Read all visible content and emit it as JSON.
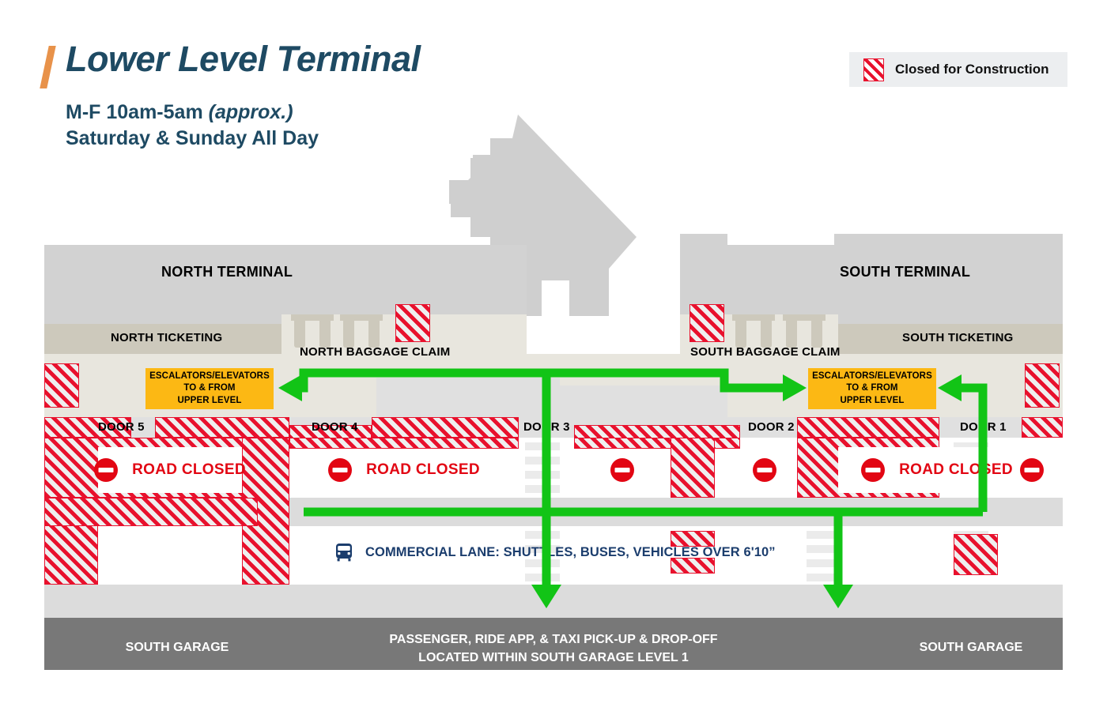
{
  "header": {
    "title": "Lower Level Terminal",
    "subtitle_line1_main": "M-F 10am-5am ",
    "subtitle_line1_italic": "(approx.)",
    "subtitle_line2": "Saturday & Sunday All Day",
    "accent_color": "#e8924a",
    "title_color": "#1e4a63"
  },
  "legend": {
    "swatch_icon": "hatched-red-square-icon",
    "label": "Closed for Construction",
    "hatch_color": "#e8112d",
    "background": "#eceef0"
  },
  "map": {
    "terminals": [
      {
        "id": "north",
        "label": "NORTH TERMINAL"
      },
      {
        "id": "south",
        "label": "SOUTH TERMINAL"
      }
    ],
    "ticketing": [
      {
        "id": "north",
        "label": "NORTH TICKETING"
      },
      {
        "id": "south",
        "label": "SOUTH TICKETING"
      }
    ],
    "baggage_claim": [
      {
        "id": "north",
        "label": "NORTH BAGGAGE CLAIM"
      },
      {
        "id": "south",
        "label": "SOUTH BAGGAGE CLAIM"
      }
    ],
    "escalator_boxes": [
      {
        "id": "north",
        "line1": "ESCALATORS/ELEVATORS",
        "line2": "TO & FROM",
        "line3": "UPPER LEVEL",
        "color": "#fcb814"
      },
      {
        "id": "south",
        "line1": "ESCALATORS/ELEVATORS",
        "line2": "TO & FROM",
        "line3": "UPPER LEVEL",
        "color": "#fcb814"
      }
    ],
    "doors": [
      {
        "id": "door5",
        "label": "DOOR 5"
      },
      {
        "id": "door4",
        "label": "DOOR 4"
      },
      {
        "id": "door3",
        "label": "DOOR 3"
      },
      {
        "id": "door2",
        "label": "DOOR 2"
      },
      {
        "id": "door1",
        "label": "DOOR 1"
      }
    ],
    "road_closed_signs": [
      {
        "id": "west",
        "label": "ROAD CLOSED",
        "icon": "no-entry-icon",
        "has_text": true
      },
      {
        "id": "center-west",
        "label": "ROAD CLOSED",
        "icon": "no-entry-icon",
        "has_text": true
      },
      {
        "id": "center",
        "label": "",
        "icon": "no-entry-icon",
        "has_text": false
      },
      {
        "id": "center-east",
        "label": "",
        "icon": "no-entry-icon",
        "has_text": false
      },
      {
        "id": "east",
        "label": "ROAD CLOSED",
        "icon": "no-entry-icon",
        "has_text": true
      },
      {
        "id": "far-east",
        "label": "",
        "icon": "no-entry-icon",
        "has_text": false
      }
    ],
    "commercial_lane": {
      "icon": "bus-icon",
      "label": "COMMERCIAL LANE: SHUTTLES, BUSES, VEHICLES OVER 6'10”",
      "color": "#1b3d6d"
    },
    "garage": {
      "left_label": "SOUTH GARAGE",
      "right_label": "SOUTH GARAGE",
      "center_line1": "PASSENGER, RIDE APP, & TAXI PICK-UP & DROP-OFF",
      "center_line2": "LOCATED WITHIN SOUTH GARAGE LEVEL 1",
      "background": "#787878"
    },
    "route": {
      "color": "#12c416",
      "description": "Green pedestrian routes from Door 1 and Door 3 to escalators and to South Garage Level 1"
    },
    "colors": {
      "terminal_fill": "#d2d2d2",
      "ticketing_fill": "#cdc9bc",
      "curb_fill": "#e8e6de",
      "median_fill": "#dcdcdc",
      "lane_fill": "#ffffff",
      "garage_fill": "#787878",
      "construction_red": "#e8112d",
      "road_closed_red": "#e20613"
    }
  }
}
